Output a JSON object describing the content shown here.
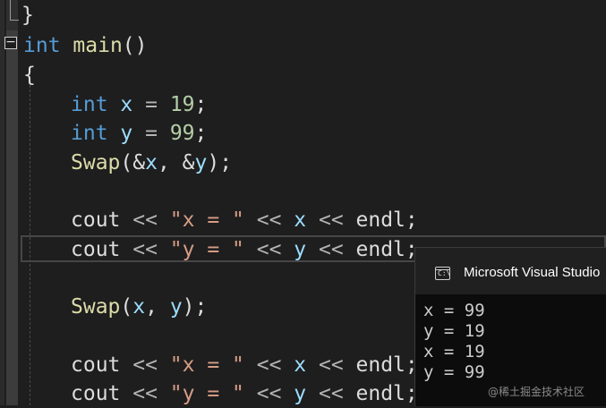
{
  "code_lines": [
    {
      "tokens": [
        {
          "t": "}",
          "c": "plain"
        }
      ]
    },
    {
      "tokens": [
        {
          "t": "int",
          "c": "kw"
        },
        {
          "t": " ",
          "c": "plain"
        },
        {
          "t": "main",
          "c": "fn"
        },
        {
          "t": "()",
          "c": "plain"
        }
      ]
    },
    {
      "tokens": [
        {
          "t": "{",
          "c": "plain"
        }
      ]
    },
    {
      "tokens": [
        {
          "t": "int",
          "c": "kw"
        },
        {
          "t": " ",
          "c": "plain"
        },
        {
          "t": "x",
          "c": "var"
        },
        {
          "t": " = ",
          "c": "op"
        },
        {
          "t": "19",
          "c": "num"
        },
        {
          "t": ";",
          "c": "plain"
        }
      ]
    },
    {
      "tokens": [
        {
          "t": "int",
          "c": "kw"
        },
        {
          "t": " ",
          "c": "plain"
        },
        {
          "t": "y",
          "c": "var"
        },
        {
          "t": " = ",
          "c": "op"
        },
        {
          "t": "99",
          "c": "num"
        },
        {
          "t": ";",
          "c": "plain"
        }
      ]
    },
    {
      "tokens": [
        {
          "t": "Swap",
          "c": "fn"
        },
        {
          "t": "(&",
          "c": "plain"
        },
        {
          "t": "x",
          "c": "var"
        },
        {
          "t": ", &",
          "c": "plain"
        },
        {
          "t": "y",
          "c": "var"
        },
        {
          "t": ");",
          "c": "plain"
        }
      ]
    },
    {
      "tokens": [
        {
          "t": "cout",
          "c": "plain"
        },
        {
          "t": " << ",
          "c": "op"
        },
        {
          "t": "\"x = \"",
          "c": "str"
        },
        {
          "t": " << ",
          "c": "op"
        },
        {
          "t": "x",
          "c": "var"
        },
        {
          "t": " << ",
          "c": "op"
        },
        {
          "t": "endl",
          "c": "plain"
        },
        {
          "t": ";",
          "c": "plain"
        }
      ]
    },
    {
      "tokens": [
        {
          "t": "cout",
          "c": "plain"
        },
        {
          "t": " << ",
          "c": "op"
        },
        {
          "t": "\"y = \"",
          "c": "str"
        },
        {
          "t": " << ",
          "c": "op"
        },
        {
          "t": "y",
          "c": "var"
        },
        {
          "t": " << ",
          "c": "op"
        },
        {
          "t": "endl",
          "c": "plain"
        },
        {
          "t": ";",
          "c": "plain"
        }
      ]
    },
    {
      "tokens": [
        {
          "t": "Swap",
          "c": "fn"
        },
        {
          "t": "(",
          "c": "plain"
        },
        {
          "t": "x",
          "c": "var"
        },
        {
          "t": ", ",
          "c": "plain"
        },
        {
          "t": "y",
          "c": "var"
        },
        {
          "t": ");",
          "c": "plain"
        }
      ]
    },
    {
      "tokens": [
        {
          "t": "cout",
          "c": "plain"
        },
        {
          "t": " << ",
          "c": "op"
        },
        {
          "t": "\"x = \"",
          "c": "str"
        },
        {
          "t": " << ",
          "c": "op"
        },
        {
          "t": "x",
          "c": "var"
        },
        {
          "t": " << ",
          "c": "op"
        },
        {
          "t": "endl",
          "c": "plain"
        },
        {
          "t": ";",
          "c": "plain"
        }
      ]
    },
    {
      "tokens": [
        {
          "t": "cout",
          "c": "plain"
        },
        {
          "t": " << ",
          "c": "op"
        },
        {
          "t": "\"y = \"",
          "c": "str"
        },
        {
          "t": " << ",
          "c": "op"
        },
        {
          "t": "y",
          "c": "var"
        },
        {
          "t": " << ",
          "c": "op"
        },
        {
          "t": "endl",
          "c": "plain"
        },
        {
          "t": ";",
          "c": "plain"
        }
      ]
    }
  ],
  "editor": {
    "fold_glyph": "−",
    "colors": {
      "keyword": "#569cd6",
      "function": "#dcdcaa",
      "variable": "#9cdcfe",
      "number": "#b5cea8",
      "string": "#d69d85",
      "background": "#1e1e1e"
    }
  },
  "console": {
    "icon": "console-window-icon",
    "icon_glyph": "C:\\",
    "title": "Microsoft Visual Studio",
    "output": [
      "x = 99",
      "y = 19",
      "x = 19",
      "y = 99"
    ]
  },
  "watermark": "@稀土掘金技术社区"
}
